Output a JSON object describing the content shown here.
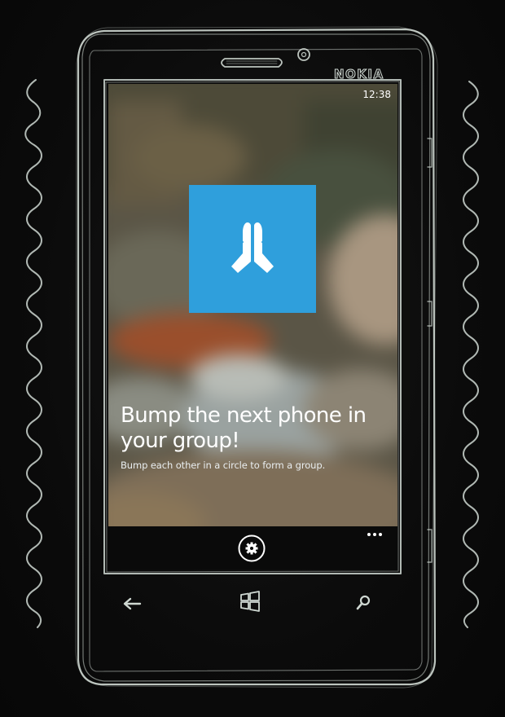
{
  "device": {
    "brand": "NOKIA"
  },
  "status_bar": {
    "time": "12:38"
  },
  "app": {
    "tile_icon": "praying-hands-icon",
    "tile_color": "#2f9fdc",
    "headline": "Bump the next phone in your group!",
    "subline": "Bump each other in a circle to form a group."
  },
  "app_bar": {
    "settings_icon": "gear-icon",
    "more_icon": "ellipsis-icon"
  },
  "hardware_buttons": {
    "back_icon": "back-arrow-icon",
    "start_icon": "windows-logo-icon",
    "search_icon": "search-icon"
  },
  "colors": {
    "sketch_line": "#cfd8d2",
    "background": "#0a0a0a",
    "app_bar": "#0a0a0a",
    "accent": "#2f9fdc"
  }
}
